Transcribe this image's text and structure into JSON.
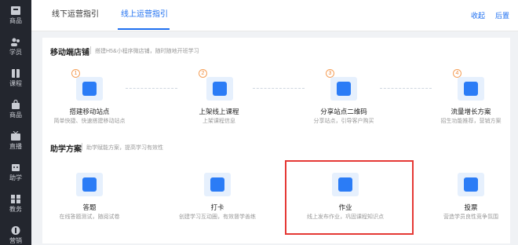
{
  "sidebar": {
    "items": [
      {
        "label": "商品"
      },
      {
        "label": "学员"
      },
      {
        "label": "课程"
      },
      {
        "label": "商品"
      },
      {
        "label": "直播"
      },
      {
        "label": "助学"
      },
      {
        "label": "教务"
      },
      {
        "label": "营销"
      }
    ]
  },
  "header": {
    "tabs": [
      {
        "label": "线下运营指引"
      },
      {
        "label": "线上运营指引"
      }
    ],
    "links": [
      {
        "label": "收起"
      },
      {
        "label": "后置"
      }
    ]
  },
  "mobile_store": {
    "title": "移动端店铺",
    "desc": "搭建H5&小程序微店铺，随时随地开班学习",
    "steps": [
      {
        "num": "1",
        "title": "搭建移动站点",
        "desc": "简单快捷、快速搭建移动站点"
      },
      {
        "num": "2",
        "title": "上架线上课程",
        "desc": "上架课程信息"
      },
      {
        "num": "3",
        "title": "分享站点二维码",
        "desc": "分享站点，引导客户购买"
      },
      {
        "num": "4",
        "title": "流量增长方案",
        "desc": "招生功能推荐，营销方案"
      }
    ]
  },
  "learning_plan": {
    "title": "助学方案",
    "desc": "助学赋能方案，提高学习有效性",
    "items": [
      {
        "title": "答题",
        "desc": "在线答题测试，随阅试卷"
      },
      {
        "title": "打卡",
        "desc": "创建学习互动圈，有效督学善练"
      },
      {
        "title": "作业",
        "desc": "线上发布作业，巩固课程知识点"
      },
      {
        "title": "投票",
        "desc": "营造学员良性竞争氛围"
      }
    ]
  },
  "colors": {
    "accent": "#1e6ff0",
    "sidebar_bg": "#23262e",
    "step_num": "#f08a3c",
    "highlight": "#e53935"
  }
}
